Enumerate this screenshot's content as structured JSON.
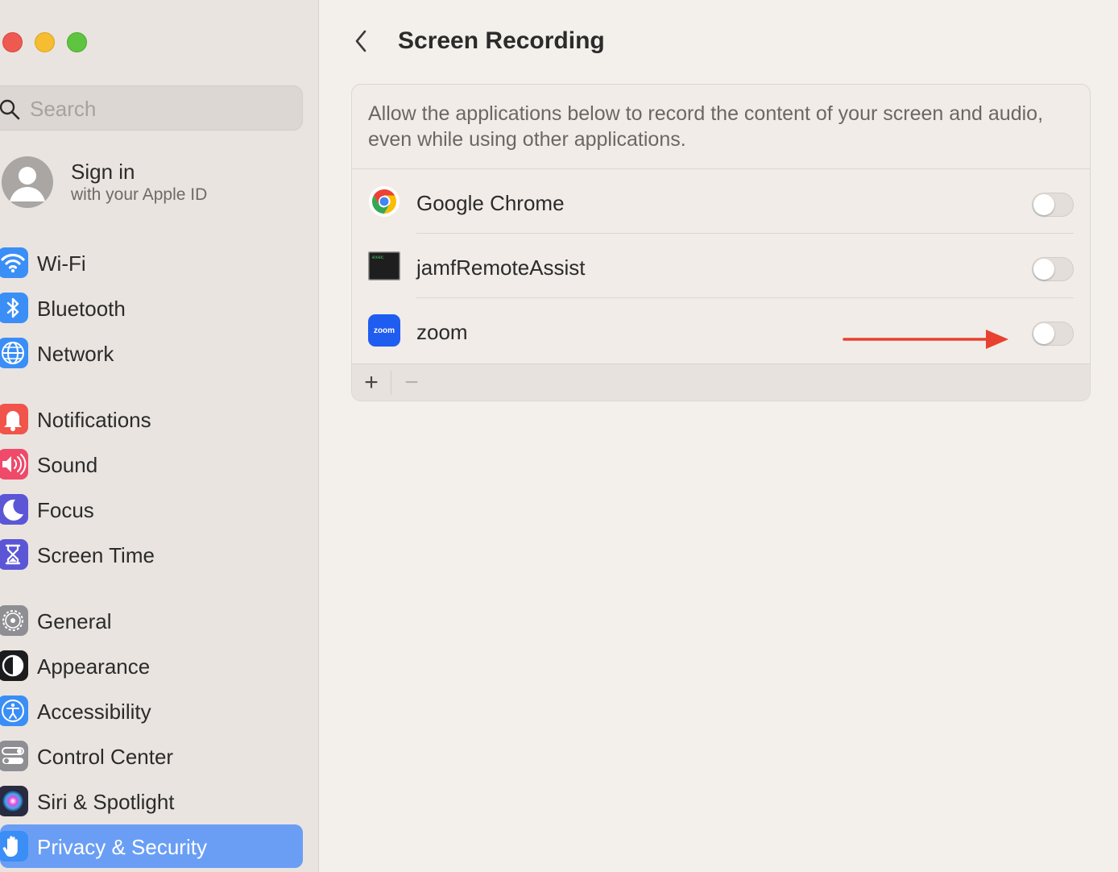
{
  "window": {
    "traffic_lights": [
      "close",
      "minimize",
      "zoom"
    ]
  },
  "sidebar": {
    "search": {
      "placeholder": "Search",
      "value": ""
    },
    "account": {
      "title": "Sign in",
      "subtitle": "with your Apple ID"
    },
    "items": [
      {
        "label": "Wi-Fi",
        "icon": "wifi-icon",
        "color": "#3a8ef6"
      },
      {
        "label": "Bluetooth",
        "icon": "bluetooth-icon",
        "color": "#3a8ef6"
      },
      {
        "label": "Network",
        "icon": "globe-icon",
        "color": "#3a8ef6"
      },
      {
        "label": "Notifications",
        "icon": "bell-icon",
        "color": "#f0544a"
      },
      {
        "label": "Sound",
        "icon": "speaker-icon",
        "color": "#ef4a6a"
      },
      {
        "label": "Focus",
        "icon": "moon-icon",
        "color": "#5b56d6"
      },
      {
        "label": "Screen Time",
        "icon": "hourglass-icon",
        "color": "#5b56d6"
      },
      {
        "label": "General",
        "icon": "gear-icon",
        "color": "#8e8e93"
      },
      {
        "label": "Appearance",
        "icon": "appearance-icon",
        "color": "#1c1c1e"
      },
      {
        "label": "Accessibility",
        "icon": "accessibility-icon",
        "color": "#3a8ef6"
      },
      {
        "label": "Control Center",
        "icon": "control-center-icon",
        "color": "#8e8e93"
      },
      {
        "label": "Siri & Spotlight",
        "icon": "siri-icon",
        "color": "#2a2a40"
      },
      {
        "label": "Privacy & Security",
        "icon": "hand-icon",
        "color": "#3a8ef6",
        "selected": true
      }
    ]
  },
  "main": {
    "title": "Screen Recording",
    "description": "Allow the applications below to record the content of your screen and audio, even while using other applications.",
    "apps": [
      {
        "name": "Google Chrome",
        "icon": "chrome-icon",
        "enabled": false
      },
      {
        "name": "jamfRemoteAssist",
        "icon": "terminal-exec-icon",
        "icon_text": "exec",
        "enabled": false
      },
      {
        "name": "zoom",
        "icon": "zoom-icon",
        "icon_text": "zoom",
        "enabled": false
      }
    ],
    "footer": {
      "add_label": "+",
      "remove_label": "−"
    },
    "annotation": {
      "type": "arrow",
      "color": "#e8412f",
      "points_to": "zoom-toggle"
    }
  }
}
